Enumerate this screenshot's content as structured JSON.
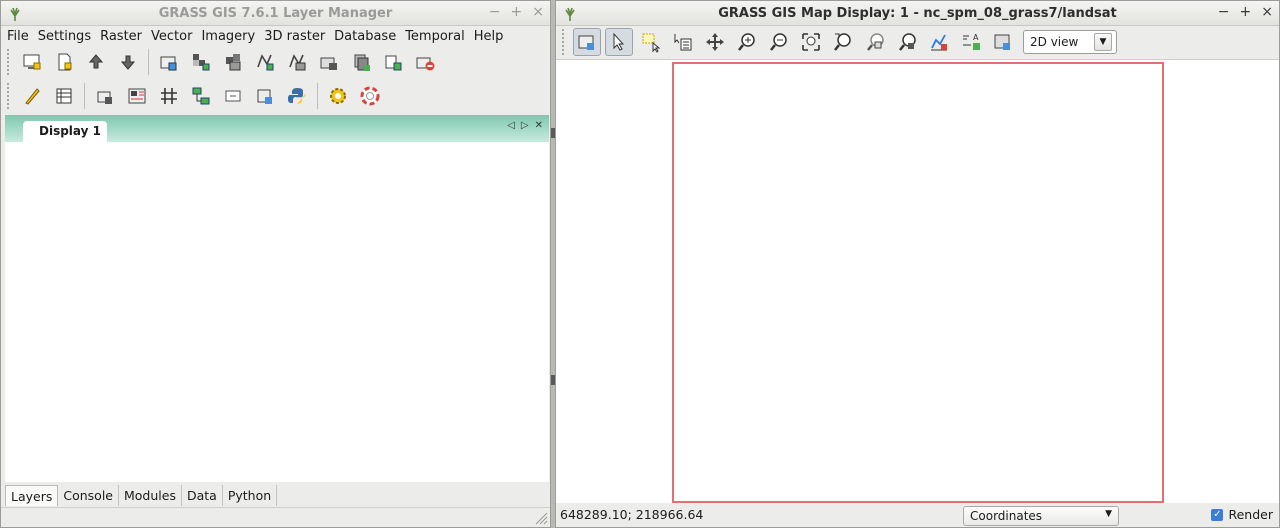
{
  "layer_manager": {
    "title": "GRASS GIS 7.6.1 Layer Manager",
    "menu": [
      "File",
      "Settings",
      "Raster",
      "Vector",
      "Imagery",
      "3D raster",
      "Database",
      "Temporal",
      "Help"
    ],
    "display_tab": "Display 1",
    "bottom_tabs": [
      "Layers",
      "Console",
      "Modules",
      "Data",
      "Python"
    ],
    "active_bottom_tab": "Layers"
  },
  "map_display": {
    "title": "GRASS GIS Map Display: 1 - nc_spm_08_grass7/landsat",
    "view_mode": "2D view",
    "coordinates": "648289.10; 218966.64",
    "coord_mode": "Coordinates",
    "render_label": "Render",
    "render_checked": true,
    "frame_color": "#e37070"
  },
  "window_controls": {
    "minimize": "−",
    "maximize": "+",
    "close": "×"
  },
  "icons": {
    "lm_toolbar1": [
      "new-display-icon",
      "new-workspace-icon",
      "open-workspace-icon",
      "save-workspace-icon",
      "add-layer-icon",
      "add-raster-icon",
      "add-raster-misc-icon",
      "add-vector-icon",
      "add-vector-misc-icon",
      "add-overlay-icon",
      "add-group-icon",
      "import-icon",
      "remove-layer-icon"
    ],
    "lm_toolbar2": [
      "vector-digitizer-icon",
      "attribute-table-icon",
      "georectifier-icon",
      "cartographic-composer-icon",
      "grid-icon",
      "graphical-modeler-icon",
      "map-swipe-icon",
      "animation-tool-icon",
      "python-icon",
      "settings-icon",
      "help-icon"
    ],
    "md_toolbar": [
      "display-map-icon",
      "pointer-icon",
      "select-icon",
      "query-icon",
      "pan-icon",
      "zoom-in-icon",
      "zoom-out-icon",
      "zoom-extent-icon",
      "zoom-back-icon",
      "zoom-menu-icon",
      "zoom-region-icon",
      "analyze-icon",
      "decorations-icon",
      "save-image-icon"
    ]
  }
}
